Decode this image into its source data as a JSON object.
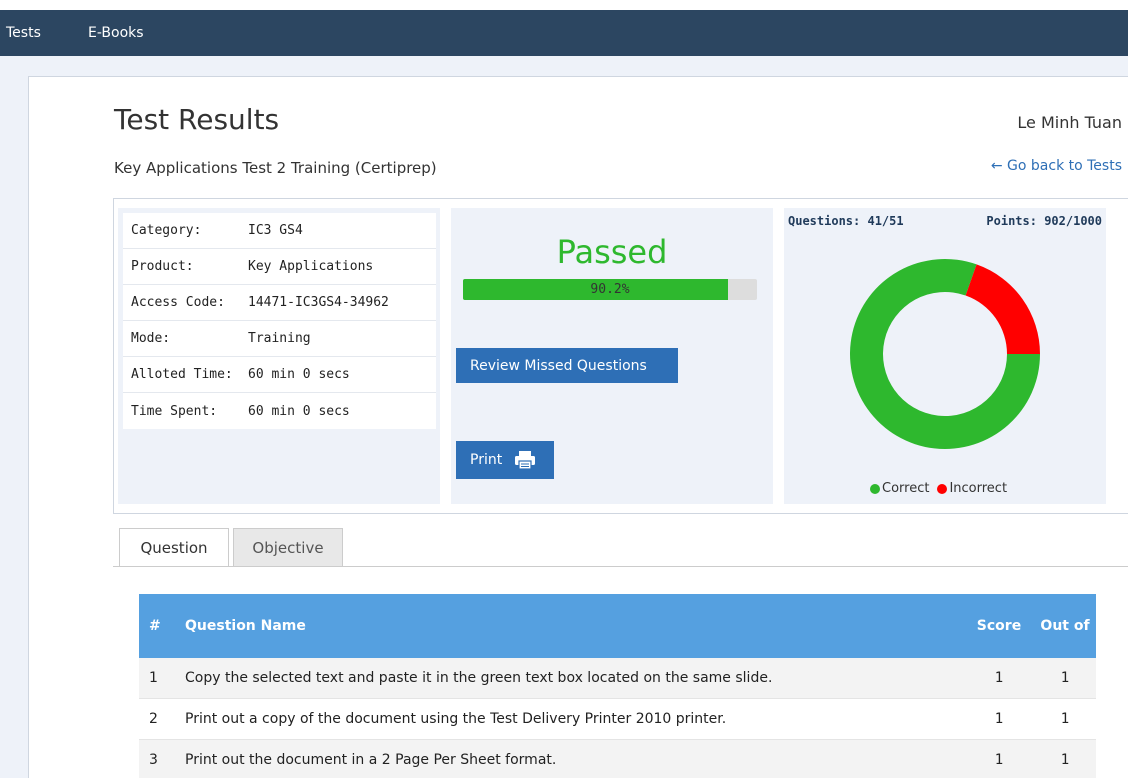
{
  "nav": {
    "items": [
      {
        "label": "Tests"
      },
      {
        "label": "E-Books"
      }
    ]
  },
  "header": {
    "title": "Test Results",
    "username": "Le Minh Tuan",
    "subtitle": "Key Applications Test 2 Training (Certiprep)",
    "back_link": "← Go back to Tests"
  },
  "info": [
    {
      "key": "Category:",
      "value": "IC3 GS4"
    },
    {
      "key": "Product:",
      "value": "Key Applications"
    },
    {
      "key": "Access Code:",
      "value": "14471-IC3GS4-34962"
    },
    {
      "key": "Mode:",
      "value": "Training"
    },
    {
      "key": "Alloted Time:",
      "value": "60 min 0 secs"
    },
    {
      "key": "Time Spent:",
      "value": "60 min 0 secs"
    }
  ],
  "result": {
    "status": "Passed",
    "progress_percent": 90.2,
    "progress_label": "90.2%",
    "review_button": "Review Missed Questions",
    "print_button": "Print"
  },
  "stats": {
    "questions": "Questions: 41/51",
    "points": "Points: 902/1000",
    "correct_color": "#2eb82e",
    "incorrect_color": "#ff0000"
  },
  "chart_data": {
    "type": "pie",
    "categories": [
      "Correct",
      "Incorrect"
    ],
    "values": [
      41,
      10
    ]
  },
  "tabs": [
    {
      "label": "Question"
    },
    {
      "label": "Objective"
    }
  ],
  "table": {
    "headers": {
      "num": "#",
      "name": "Question Name",
      "score": "Score",
      "out": "Out of"
    },
    "rows": [
      {
        "num": "1",
        "name": "Copy the selected text and paste it in the green text box located on the same slide.",
        "score": "1",
        "out": "1"
      },
      {
        "num": "2",
        "name": "Print out a copy of the document using the Test Delivery Printer 2010 printer.",
        "score": "1",
        "out": "1"
      },
      {
        "num": "3",
        "name": "Print out the document in a 2 Page Per Sheet format.",
        "score": "1",
        "out": "1"
      }
    ]
  }
}
